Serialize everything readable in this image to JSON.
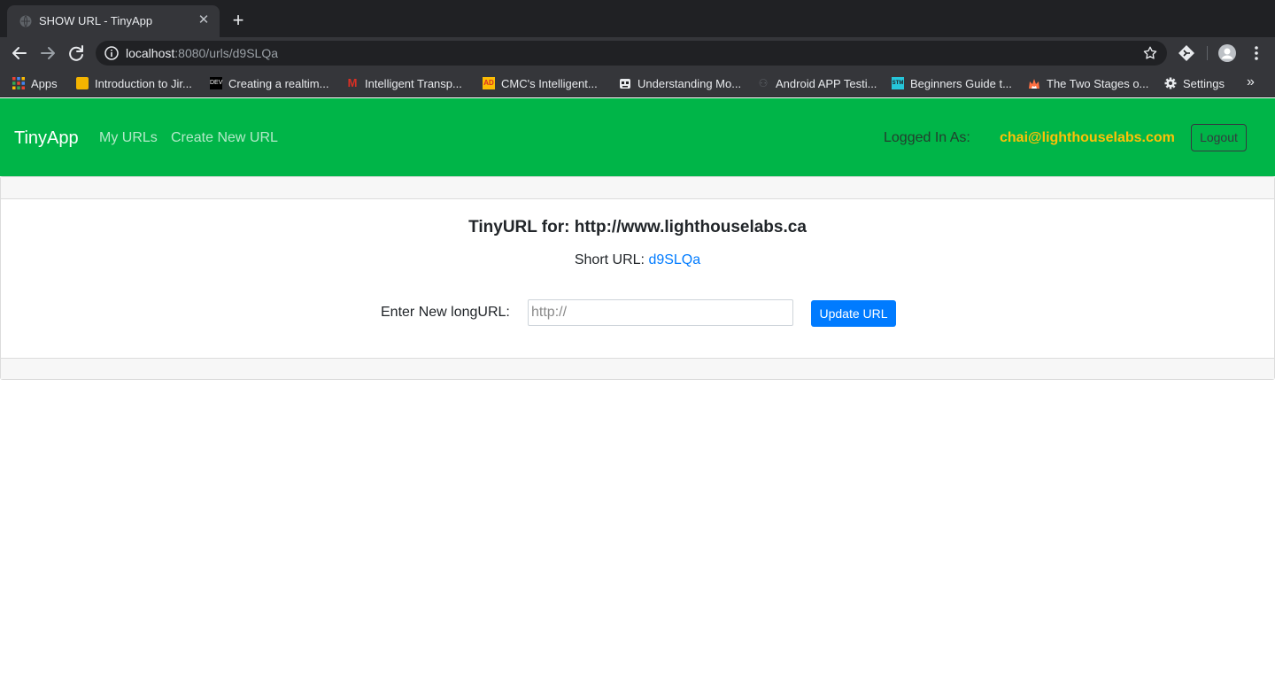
{
  "browser": {
    "tab_title": "SHOW URL - TinyApp",
    "tab_close": "✕",
    "new_tab": "+",
    "url_host": "localhost",
    "url_path": ":8080/urls/d9SLQa",
    "bookmarks": [
      {
        "label": "Apps",
        "icon": "apps-grid-icon",
        "color": "#4285f4"
      },
      {
        "label": "Introduction to Jir...",
        "icon": "jira-icon",
        "color": "#f4b400"
      },
      {
        "label": "Creating a realtim...",
        "icon": "dev-icon",
        "color": "#000000"
      },
      {
        "label": "Intelligent Transp...",
        "icon": "m-logo-icon",
        "color": "#d93025"
      },
      {
        "label": "CMC's Intelligent...",
        "icon": "ad-logo-icon",
        "color": "#fbbc04"
      },
      {
        "label": "Understanding Mo...",
        "icon": "robot-icon",
        "color": "#e8eaed"
      },
      {
        "label": "Android APP Testi...",
        "icon": "android-icon",
        "color": "#5f6368"
      },
      {
        "label": "Beginners Guide t...",
        "icon": "stm-icon",
        "color": "#26c6da"
      },
      {
        "label": "The Two Stages o...",
        "icon": "flame-icon",
        "color": "#ff7043"
      },
      {
        "label": "Settings",
        "icon": "gear-icon",
        "color": "#e8eaed"
      }
    ],
    "more_bookmarks": "»"
  },
  "navbar": {
    "brand": "TinyApp",
    "my_urls": "My URLs",
    "create_new": "Create New URL",
    "logged_in_label": "Logged In As:",
    "user_email": "chai@lighthouselabs.com",
    "logout": "Logout",
    "bg_color": "#00b548"
  },
  "main": {
    "title": "TinyURL for: http://www.lighthouselabs.ca",
    "short_url_label": "Short URL: ",
    "short_url_code": "d9SLQa",
    "form_label": "Enter New longURL:",
    "input_placeholder": "http://",
    "input_value": "",
    "update_button": "Update URL"
  }
}
